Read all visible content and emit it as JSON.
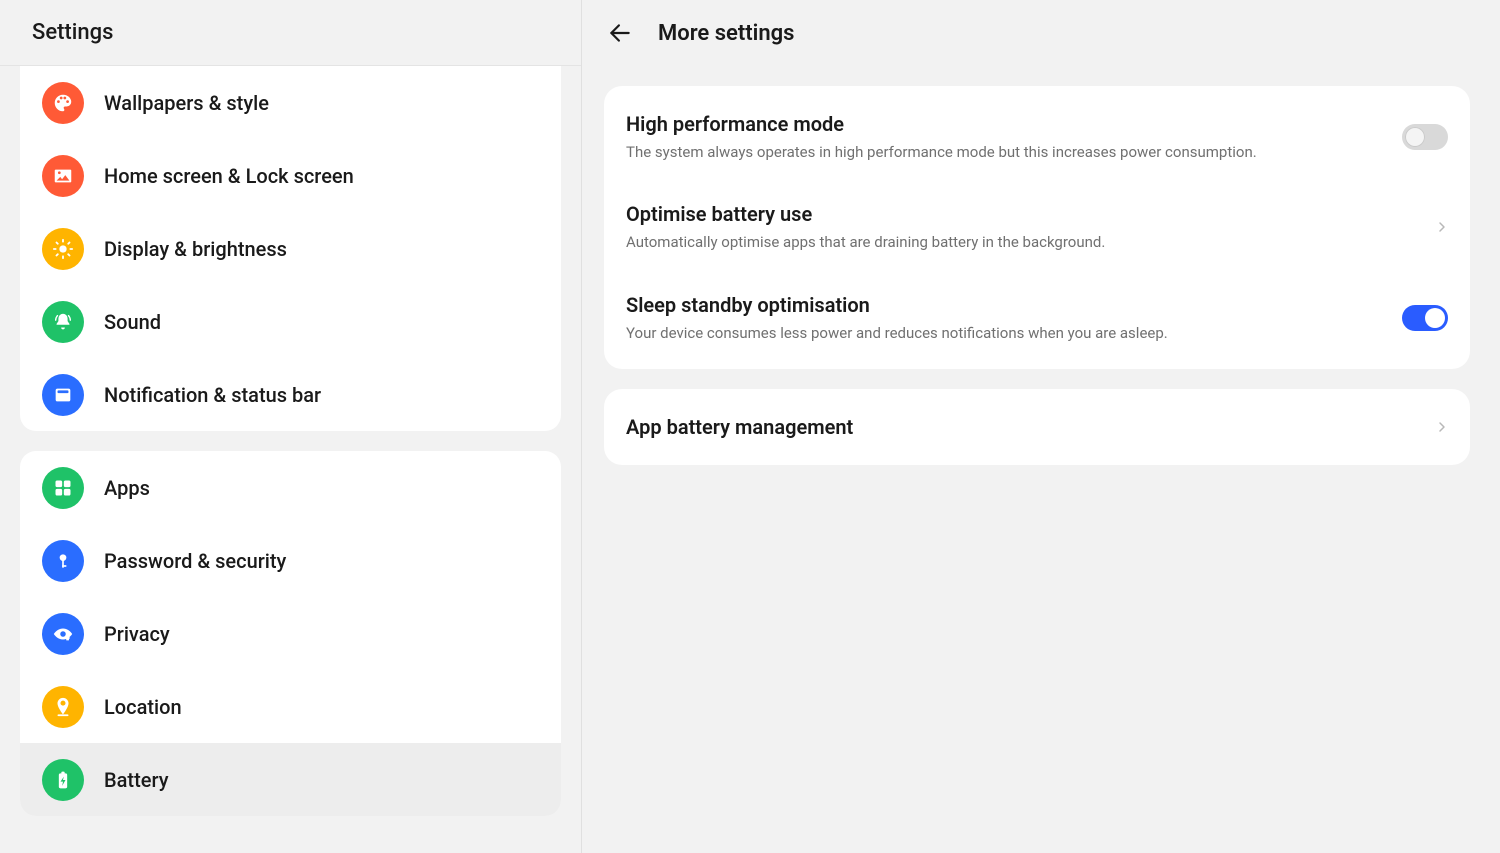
{
  "sidebar": {
    "title": "Settings",
    "groups": [
      {
        "items": [
          {
            "id": "wallpapers",
            "label": "Wallpapers & style",
            "color": "#ff5a36"
          },
          {
            "id": "home-lock",
            "label": "Home screen & Lock screen",
            "color": "#ff5a36"
          },
          {
            "id": "display",
            "label": "Display & brightness",
            "color": "#ffb400"
          },
          {
            "id": "sound",
            "label": "Sound",
            "color": "#1fc268"
          },
          {
            "id": "notif",
            "label": "Notification & status bar",
            "color": "#2a6dff"
          }
        ]
      },
      {
        "items": [
          {
            "id": "apps",
            "label": "Apps",
            "color": "#1fc268"
          },
          {
            "id": "security",
            "label": "Password & security",
            "color": "#2a6dff"
          },
          {
            "id": "privacy",
            "label": "Privacy",
            "color": "#2a6dff"
          },
          {
            "id": "location",
            "label": "Location",
            "color": "#ffb400"
          },
          {
            "id": "battery",
            "label": "Battery",
            "color": "#1fc268",
            "selected": true
          }
        ]
      }
    ]
  },
  "main": {
    "title": "More settings",
    "groups": [
      {
        "rows": [
          {
            "id": "perf",
            "title": "High performance mode",
            "desc": "The system always operates in high performance mode but this increases power consumption.",
            "control": "toggle",
            "on": false
          },
          {
            "id": "optim",
            "title": "Optimise battery use",
            "desc": "Automatically optimise apps that are draining battery in the background.",
            "control": "chevron"
          },
          {
            "id": "sleep",
            "title": "Sleep standby optimisation",
            "desc": "Your device consumes less power and reduces notifications when you are asleep.",
            "control": "toggle",
            "on": true
          }
        ]
      },
      {
        "rows": [
          {
            "id": "appmgmt",
            "title": "App battery management",
            "control": "chevron"
          }
        ]
      }
    ]
  }
}
